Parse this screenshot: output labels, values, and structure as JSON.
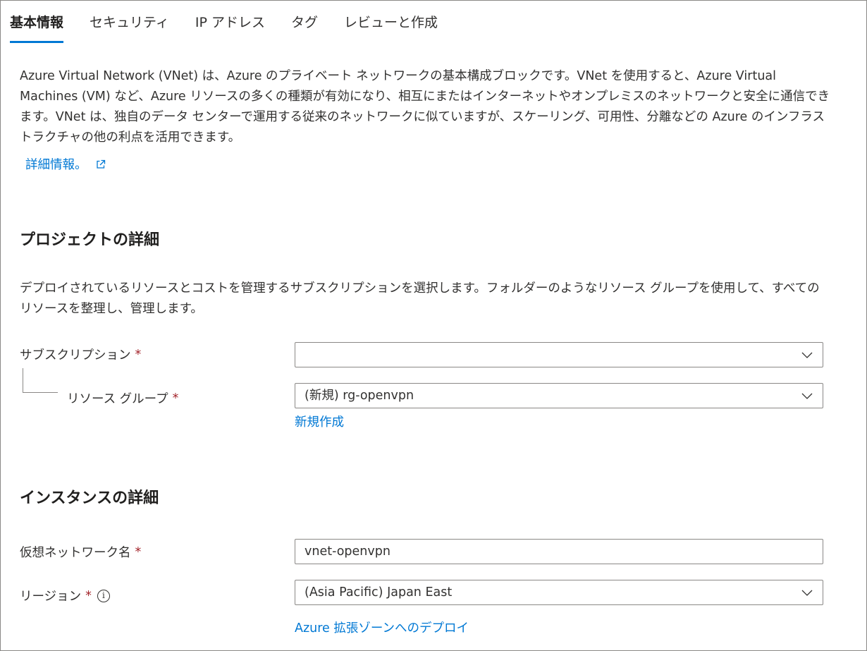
{
  "tabs": [
    {
      "label": "基本情報",
      "active": true
    },
    {
      "label": "セキュリティ",
      "active": false
    },
    {
      "label": "IP アドレス",
      "active": false
    },
    {
      "label": "タグ",
      "active": false
    },
    {
      "label": "レビューと作成",
      "active": false
    }
  ],
  "intro": {
    "text": "Azure Virtual Network (VNet) は、Azure のプライベート ネットワークの基本構成ブロックです。VNet を使用すると、Azure Virtual Machines (VM) など、Azure リソースの多くの種類が有効になり、相互にまたはインターネットやオンプレミスのネットワークと安全に通信できます。VNet は、独自のデータ センターで運用する従来のネットワークに似ていますが、スケーリング、可用性、分離などの Azure のインフラストラクチャの他の利点を活用できます。",
    "learn_more": "詳細情報。",
    "learn_more_icon": "external-link-icon"
  },
  "project": {
    "title": "プロジェクトの詳細",
    "description": "デプロイされているリソースとコストを管理するサブスクリプションを選択します。フォルダーのようなリソース グループを使用して、すべてのリソースを整理し、管理します。",
    "subscription_label": "サブスクリプション",
    "subscription_value": "",
    "resource_group_label": "リソース グループ",
    "resource_group_value": "(新規) rg-openvpn",
    "create_new": "新規作成"
  },
  "instance": {
    "title": "インスタンスの詳細",
    "vnet_name_label": "仮想ネットワーク名",
    "vnet_name_value": "vnet-openvpn",
    "region_label": "リージョン",
    "region_info_icon": "info-icon",
    "region_value": "(Asia Pacific) Japan East",
    "extended_zone_link": "Azure 拡張ゾーンへのデプロイ"
  },
  "required_marker": "*",
  "colors": {
    "accent": "#0078d4",
    "required": "#a4262c",
    "border": "#8a8886",
    "text": "#323130"
  }
}
